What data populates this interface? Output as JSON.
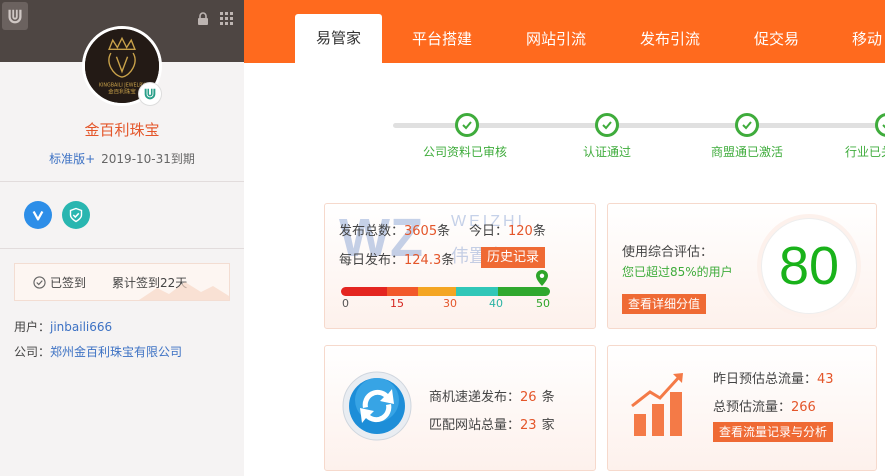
{
  "sidebar": {
    "company_name": "金百利珠宝",
    "avatar_brand_top": "KINGBAILI JEWELRY",
    "avatar_brand_bottom": "金百利珠宝",
    "version_label": "标准版+",
    "expire_text": "2019-10-31到期",
    "checkin": {
      "checked_label": "已签到",
      "total_label": "累计签到22天"
    },
    "user_label": "用户：",
    "user_value": "jinbaili666",
    "company_label": "公司：",
    "company_value": "郑州金百利珠宝有限公司"
  },
  "nav": {
    "tabs": [
      {
        "label": "易管家",
        "active": true
      },
      {
        "label": "平台搭建"
      },
      {
        "label": "网站引流"
      },
      {
        "label": "发布引流"
      },
      {
        "label": "促交易"
      },
      {
        "label": "移动"
      }
    ]
  },
  "steps": [
    {
      "label": "公司资料已审核"
    },
    {
      "label": "认证通过"
    },
    {
      "label": "商盟通已激活"
    },
    {
      "label": "行业已关"
    }
  ],
  "publish_card": {
    "total_label": "发布总数：",
    "total_value": "3605",
    "total_unit": "条",
    "today_label": "今日：",
    "today_value": "120",
    "today_unit": "条",
    "daily_label": "每日发布：",
    "daily_value": "124.3",
    "daily_unit": "条",
    "history_button": "历史记录",
    "scale_ticks": [
      "0",
      "15",
      "30",
      "40",
      "50"
    ],
    "watermark_text": "WEIZHI",
    "watermark_sub": "伟置电子",
    "progress_fraction": 1.0
  },
  "score_card": {
    "title": "使用综合评估：",
    "summary": "您已超过85%的用户",
    "detail_button": "查看详细分值",
    "score": "80"
  },
  "opportunity_card": {
    "publish_label": "商机速递发布：",
    "publish_value": "26",
    "publish_unit": "条",
    "sites_label": "匹配网站总量：",
    "sites_value": "23",
    "sites_unit": "家"
  },
  "traffic_card": {
    "yesterday_label": "昨日预估总流量：",
    "yesterday_value": "43",
    "total_label": "总预估流量：",
    "total_value": "266",
    "records_button": "查看流量记录与分析"
  },
  "colors": {
    "accent": "#ff6a1e",
    "success": "#3fac3c",
    "link": "#3d72c4",
    "score": "#19b21a"
  }
}
